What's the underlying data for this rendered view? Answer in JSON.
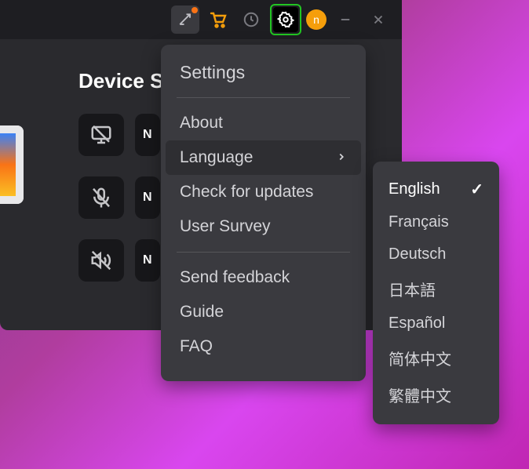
{
  "titlebar": {
    "avatar_letter": "n"
  },
  "section": {
    "title_visible": "Device S"
  },
  "device_rows": [
    {
      "label_visible": "N"
    },
    {
      "label_visible": "N"
    },
    {
      "label_visible": "N"
    }
  ],
  "settings_menu": {
    "heading": "Settings",
    "group1": [
      "About",
      "Language",
      "Check for updates",
      "User Survey"
    ],
    "group2": [
      "Send feedback",
      "Guide",
      "FAQ"
    ],
    "selected_index": 1
  },
  "language_menu": {
    "options": [
      "English",
      "Français",
      "Deutsch",
      "日本語",
      "Español",
      "简体中文",
      "繁體中文"
    ],
    "selected_index": 0
  }
}
